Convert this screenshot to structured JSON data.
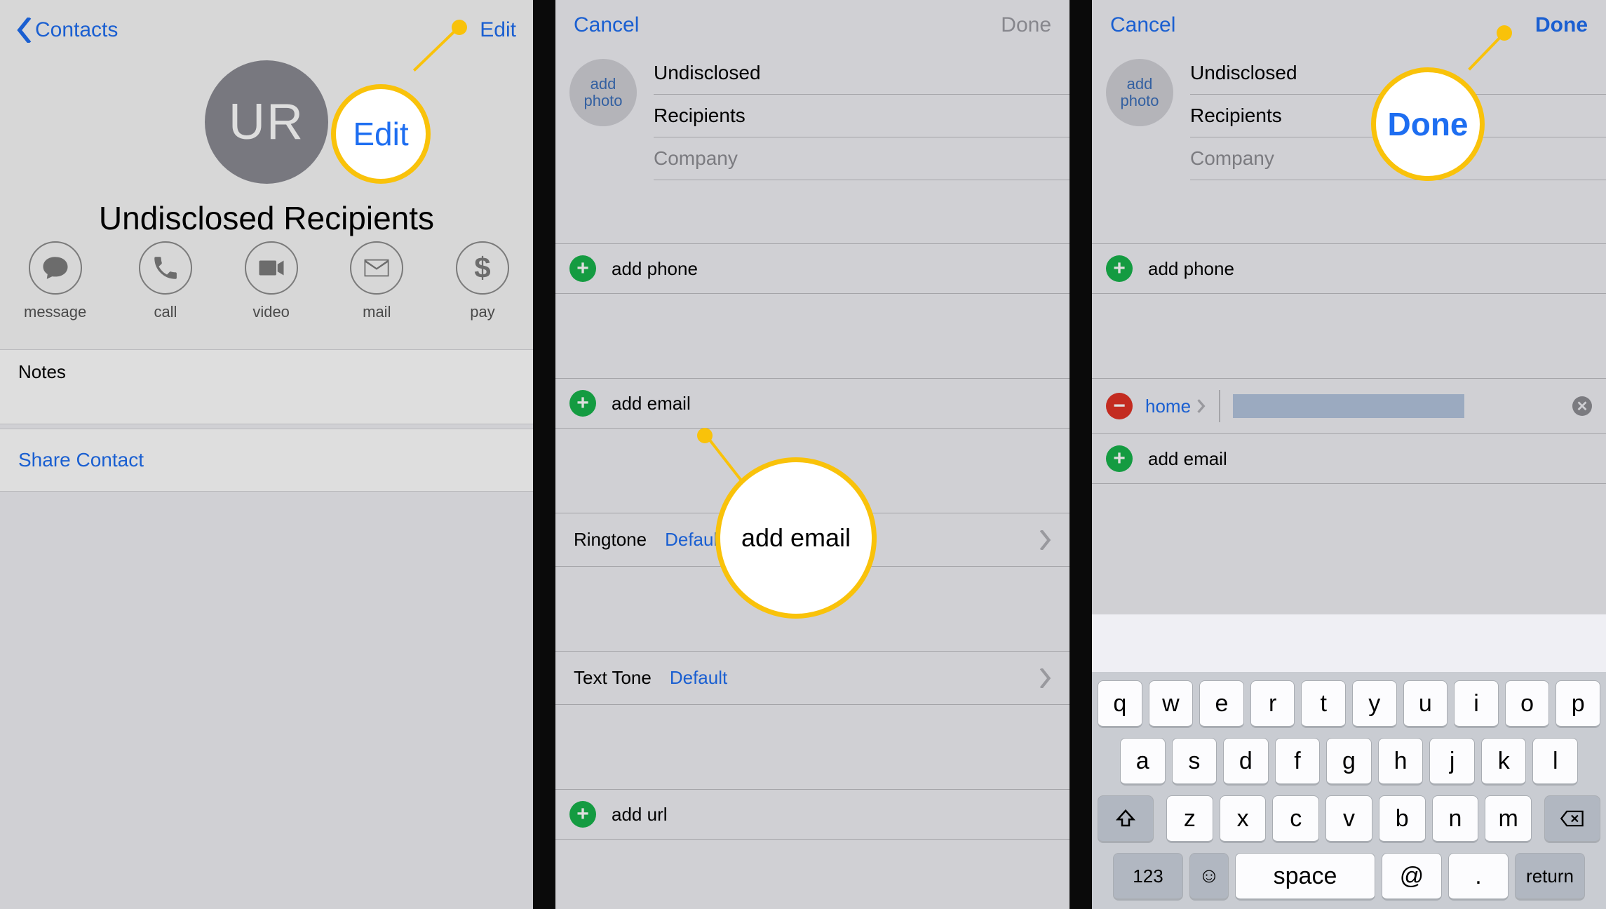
{
  "panel1": {
    "back_label": "Contacts",
    "edit_label": "Edit",
    "avatar_initials": "UR",
    "contact_name": "Undisclosed Recipients",
    "actions": {
      "message": "message",
      "call": "call",
      "video": "video",
      "mail": "mail",
      "pay": "pay"
    },
    "pay_glyph": "$",
    "notes_label": "Notes",
    "share_label": "Share Contact",
    "callout_label": "Edit"
  },
  "panel2": {
    "cancel": "Cancel",
    "done": "Done",
    "add_photo": "add photo",
    "first_name": "Undisclosed",
    "last_name": "Recipients",
    "company_ph": "Company",
    "add_phone": "add phone",
    "add_email": "add email",
    "ringtone_label": "Ringtone",
    "ringtone_value": "Default",
    "texttone_label": "Text Tone",
    "texttone_value": "Default",
    "add_url": "add url",
    "callout_label": "add email"
  },
  "panel3": {
    "cancel": "Cancel",
    "done": "Done",
    "add_photo": "add photo",
    "first_name": "Undisclosed",
    "last_name": "Recipients",
    "company_ph": "Company",
    "add_phone": "add phone",
    "email_label": "home",
    "add_email": "add email",
    "callout_label": "Done",
    "keyboard": {
      "r1": [
        "q",
        "w",
        "e",
        "r",
        "t",
        "y",
        "u",
        "i",
        "o",
        "p"
      ],
      "r2": [
        "a",
        "s",
        "d",
        "f",
        "g",
        "h",
        "j",
        "k",
        "l"
      ],
      "r3": [
        "z",
        "x",
        "c",
        "v",
        "b",
        "n",
        "m"
      ],
      "num": "123",
      "space": "space",
      "at": "@",
      "dot": ".",
      "ret": "return"
    }
  }
}
